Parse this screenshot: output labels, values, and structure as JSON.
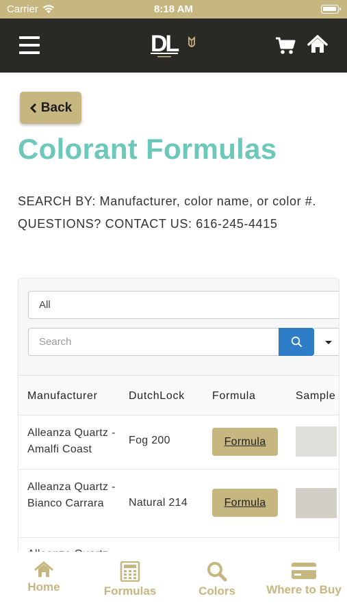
{
  "status_bar": {
    "carrier": "Carrier",
    "time": "8:18 AM"
  },
  "app_bar": {
    "logo_text": "DL",
    "logo_subtext": "DUTCHLOCK"
  },
  "back_button": {
    "label": "Back"
  },
  "page_title": "Colorant Formulas",
  "info": {
    "search_label": "SEARCH BY:",
    "search_text": "Manufacturer, color name, or color #.",
    "questions_label": "QUESTIONS? CONTACT US:",
    "phone": "616-245-4415"
  },
  "filter": {
    "select_value": "All",
    "search_placeholder": "Search"
  },
  "table": {
    "headers": [
      "Manufacturer",
      "DutchLock",
      "Formula",
      "Sample"
    ],
    "rows": [
      {
        "manufacturer": "Alleanza Quartz - Amalfi Coast",
        "dutchlock": "Fog 200",
        "formula": "Formula",
        "sample_color": "#e0ded9"
      },
      {
        "manufacturer": "Alleanza Quartz - Bianco Carrara",
        "dutchlock": "Natural 214",
        "formula": "Formula",
        "sample_color": "#d2cfc7"
      },
      {
        "manufacturer": "Alleanza Quartz",
        "dutchlock": "",
        "formula": "",
        "sample_color": ""
      }
    ]
  },
  "tab_bar": {
    "items": [
      {
        "label": "Home",
        "icon": "home-icon"
      },
      {
        "label": "Formulas",
        "icon": "calculator-icon"
      },
      {
        "label": "Colors",
        "icon": "search-icon"
      },
      {
        "label": "Where to Buy",
        "icon": "credit-card-icon"
      }
    ]
  },
  "colors": {
    "gold": "#c6b680",
    "dark": "#2a2925",
    "teal": "#6cc8b8",
    "blue": "#2f7cc7"
  }
}
